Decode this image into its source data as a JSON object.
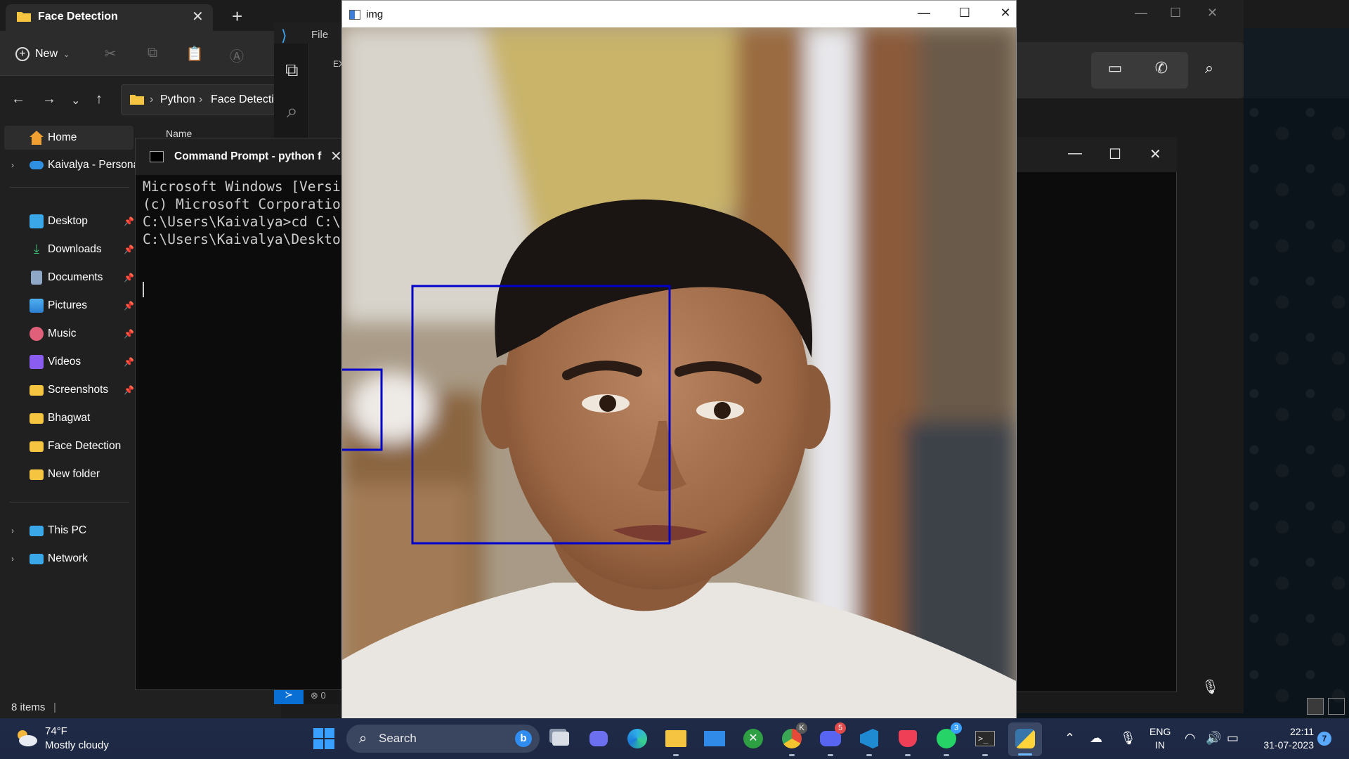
{
  "explorer": {
    "tab_title": "Face Detection",
    "new_label": "New",
    "breadcrumb": [
      "Python",
      "Face Detectio"
    ],
    "column_header": "Name",
    "sidebar": {
      "home": "Home",
      "onedrive": "Kaivalya - Personal",
      "pinned": [
        "Desktop",
        "Downloads",
        "Documents",
        "Pictures",
        "Music",
        "Videos",
        "Screenshots"
      ],
      "folders": [
        "Bhagwat",
        "Face Detection",
        "New folder"
      ],
      "this_pc": "This PC",
      "network": "Network"
    },
    "status": "8 items"
  },
  "vscode": {
    "menu_file": "File",
    "explorer_label": "EX",
    "errors": "0"
  },
  "cmd": {
    "title": "Command Prompt - python f",
    "lines": [
      "Microsoft Windows [Versi",
      "(c) Microsoft Corporatio",
      "",
      "C:\\Users\\Kaivalya>cd C:\\",
      "",
      "C:\\Users\\Kaivalya\\Deskto"
    ]
  },
  "img_window": {
    "title": "img",
    "detections": [
      {
        "label": "face",
        "color": "#0000ff"
      },
      {
        "label": "false-positive",
        "color": "#0000ff"
      }
    ]
  },
  "taskbar": {
    "weather_temp": "74°F",
    "weather_condition": "Mostly cloudy",
    "search_placeholder": "Search",
    "apps": [
      "task-view",
      "teams-chat",
      "edge",
      "file-explorer",
      "mail",
      "xbox",
      "chrome",
      "discord",
      "vscode",
      "pocket",
      "whatsapp",
      "terminal",
      "python"
    ],
    "badges": {
      "discord": "5",
      "whatsapp": "3",
      "chrome": "K"
    },
    "language": [
      "ENG",
      "IN"
    ],
    "time": "22:11",
    "date": "31-07-2023",
    "notifications": "7"
  },
  "colors": {
    "accent": "#3aa0ff",
    "detection_box": "#0000cc",
    "taskbar": "#1f2a47"
  }
}
